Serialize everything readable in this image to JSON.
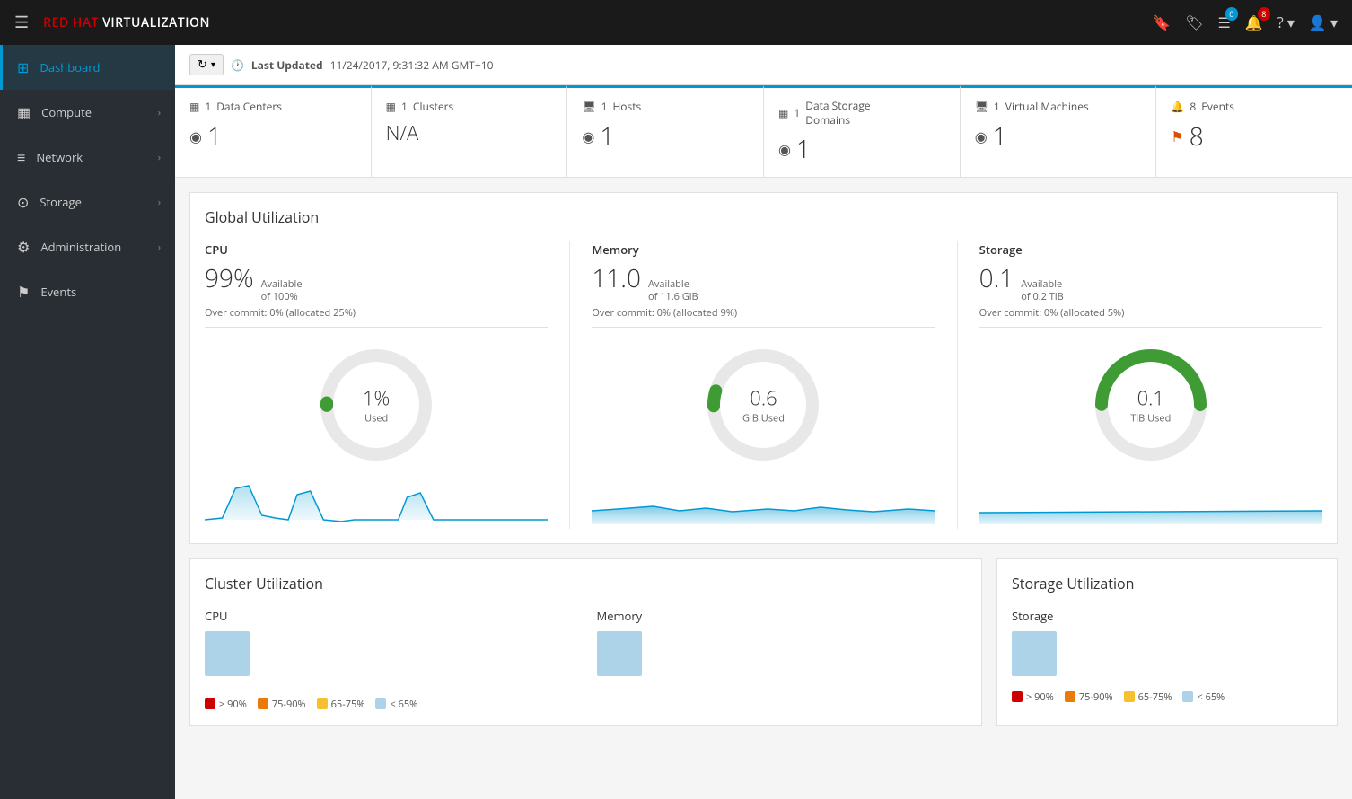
{
  "brand": {
    "name": "RED HAT VIRTUALIZATION",
    "red": "RED HAT"
  },
  "topnav": {
    "bookmark_badge": "",
    "tags_icon": "🏷",
    "list_badge": "0",
    "bell_badge": "8",
    "help_label": "?",
    "user_label": "👤"
  },
  "sidebar": {
    "items": [
      {
        "id": "dashboard",
        "label": "Dashboard",
        "icon": "⊞",
        "active": true,
        "hasArrow": false
      },
      {
        "id": "compute",
        "label": "Compute",
        "icon": "▦",
        "active": false,
        "hasArrow": true
      },
      {
        "id": "network",
        "label": "Network",
        "icon": "≡",
        "active": false,
        "hasArrow": true
      },
      {
        "id": "storage",
        "label": "Storage",
        "icon": "⊙",
        "active": false,
        "hasArrow": true
      },
      {
        "id": "administration",
        "label": "Administration",
        "icon": "⚙",
        "active": false,
        "hasArrow": true
      },
      {
        "id": "events",
        "label": "Events",
        "icon": "⚑",
        "active": false,
        "hasArrow": false
      }
    ]
  },
  "topbar": {
    "refresh_label": "↻",
    "dropdown_label": "▾",
    "last_updated_label": "Last Updated",
    "last_updated_time": "11/24/2017, 9:31:32 AM GMT+10",
    "clock_icon": "🕐"
  },
  "summary_cards": [
    {
      "id": "data-centers",
      "icon": "▦",
      "count": "1",
      "title": "Data Centers",
      "value": "1",
      "value_icon": "◉",
      "is_na": false
    },
    {
      "id": "clusters",
      "icon": "▦",
      "count": "1",
      "title": "Clusters",
      "value": "N/A",
      "value_icon": "",
      "is_na": true
    },
    {
      "id": "hosts",
      "icon": "🖥",
      "count": "1",
      "title": "Hosts",
      "value": "1",
      "value_icon": "◉",
      "is_na": false
    },
    {
      "id": "data-storage-domains",
      "icon": "▦",
      "count": "1",
      "title": "Data Storage Domains",
      "value": "1",
      "value_icon": "◉",
      "is_na": false
    },
    {
      "id": "virtual-machines",
      "icon": "🖥",
      "count": "1",
      "title": "Virtual Machines",
      "value": "1",
      "value_icon": "◉",
      "is_na": false
    },
    {
      "id": "events",
      "icon": "🔔",
      "count": "8",
      "title": "Events",
      "value": "8",
      "value_icon": "⚑",
      "is_na": false
    }
  ],
  "global_utilization": {
    "title": "Global Utilization",
    "cpu": {
      "title": "CPU",
      "big": "99%",
      "sub_line1": "Available",
      "sub_line2": "of 100%",
      "overcommit": "Over commit: 0% (allocated 25%)",
      "donut_val": "1%",
      "donut_label": "Used",
      "donut_percent": 1,
      "donut_color": "#3f9c35"
    },
    "memory": {
      "title": "Memory",
      "big": "11.0",
      "sub_line1": "Available",
      "sub_line2": "of 11.6 GiB",
      "overcommit": "Over commit: 0% (allocated 9%)",
      "donut_val": "0.6",
      "donut_label": "GiB Used",
      "donut_percent": 5,
      "donut_color": "#3f9c35"
    },
    "storage": {
      "title": "Storage",
      "big": "0.1",
      "sub_line1": "Available",
      "sub_line2": "of 0.2 TiB",
      "overcommit": "Over commit: 0% (allocated 5%)",
      "donut_val": "0.1",
      "donut_label": "TiB Used",
      "donut_percent": 50,
      "donut_color": "#3f9c35"
    }
  },
  "cluster_utilization": {
    "title": "Cluster Utilization",
    "cpu_title": "CPU",
    "memory_title": "Memory",
    "legend": [
      {
        "color": "red",
        "label": "> 90%"
      },
      {
        "color": "orange",
        "label": "75-90%"
      },
      {
        "color": "yellow",
        "label": "65-75%"
      },
      {
        "color": "light-blue",
        "label": "< 65%"
      }
    ]
  },
  "storage_utilization": {
    "title": "Storage Utilization",
    "storage_title": "Storage",
    "legend": [
      {
        "color": "red",
        "label": "> 90%"
      },
      {
        "color": "orange",
        "label": "75-90%"
      },
      {
        "color": "yellow",
        "label": "65-75%"
      },
      {
        "color": "light-blue",
        "label": "< 65%"
      }
    ]
  }
}
